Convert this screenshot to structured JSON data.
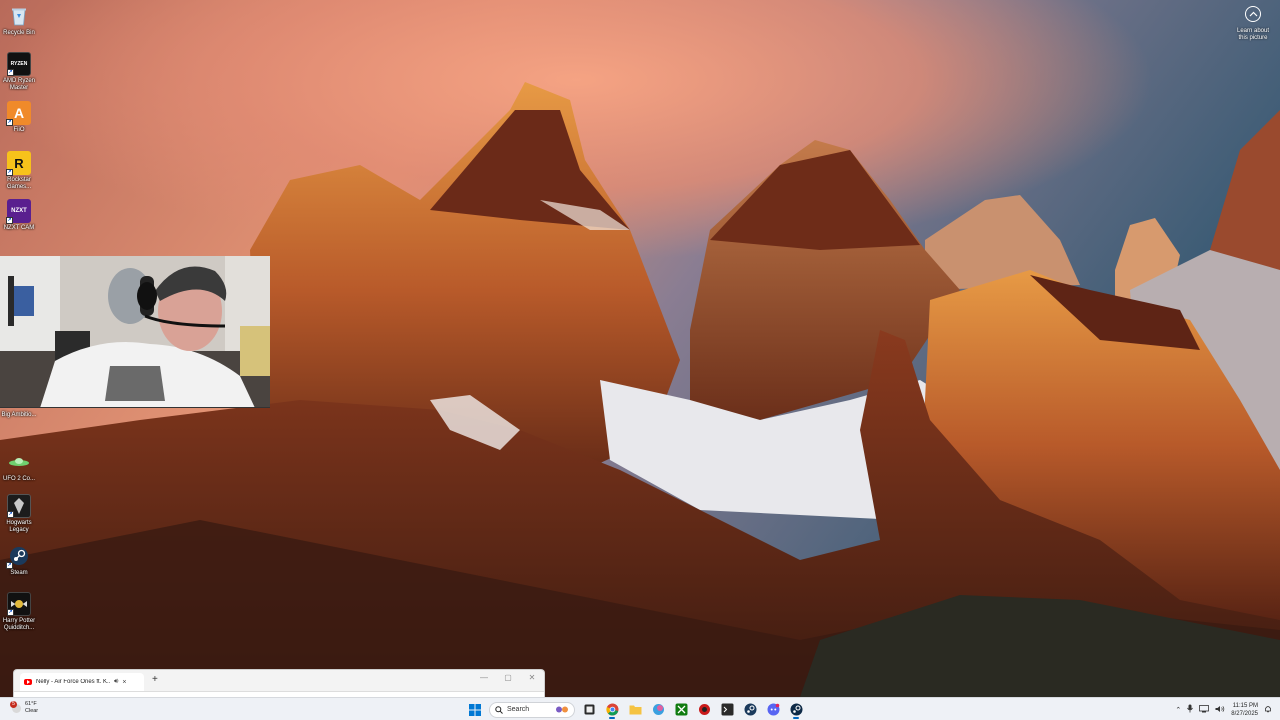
{
  "desktop": {
    "icons": [
      {
        "label": "Recycle Bin",
        "icon": "recycle-bin-icon"
      },
      {
        "label": "AMD Ryzen Master",
        "icon": "ryzen-master-icon",
        "tile_text": "RYZEN"
      },
      {
        "label": "FiiO",
        "icon": "fiio-icon",
        "tile_text": "A"
      },
      {
        "label": "Rockstar Games...",
        "icon": "rockstar-icon",
        "tile_text": "R"
      },
      {
        "label": "NZXT CAM",
        "icon": "nzxt-cam-icon",
        "tile_text": "NZXT"
      },
      {
        "label": "Big Ambitio...",
        "icon": "big-ambitions-icon"
      },
      {
        "label": "UFO 2 Co...",
        "icon": "ufo-icon"
      },
      {
        "label": "Hogwarts Legacy",
        "icon": "hogwarts-legacy-icon"
      },
      {
        "label": "Steam",
        "icon": "steam-icon"
      },
      {
        "label": "Harry Potter Quidditch...",
        "icon": "quidditch-icon"
      }
    ],
    "learn_about": {
      "label": "Learn about this picture",
      "icon": "camera-info-icon"
    }
  },
  "browser": {
    "tab_title": "Nelly - Air Force Ones ft. K...",
    "new_tab_label": "+",
    "close_tab_label": "×",
    "minimize_label": "—",
    "maximize_label": "▢",
    "close_label": "✕"
  },
  "taskbar": {
    "weather": {
      "temp": "61°F",
      "condition": "Clear",
      "badge": "5"
    },
    "search_placeholder": "Search",
    "apps": [
      {
        "name": "file-explorer-icon",
        "active": false
      },
      {
        "name": "task-view-icon",
        "active": false
      },
      {
        "name": "chrome-icon",
        "active": true
      },
      {
        "name": "folder-icon",
        "active": false
      },
      {
        "name": "copilot-icon",
        "active": false
      },
      {
        "name": "xbox-icon",
        "active": false
      },
      {
        "name": "rockstar-launcher-icon",
        "active": false
      },
      {
        "name": "terminal-icon",
        "active": false
      },
      {
        "name": "steam-taskbar-icon",
        "active": false
      },
      {
        "name": "discord-icon",
        "active": false
      },
      {
        "name": "steam-active-icon",
        "active": true
      }
    ],
    "clock": {
      "time": "11:15 PM",
      "date": "8/27/2025"
    }
  },
  "colors": {
    "accent": "#0067c0",
    "taskbar_bg": "#eef1f6",
    "youtube_red": "#ff0000"
  }
}
